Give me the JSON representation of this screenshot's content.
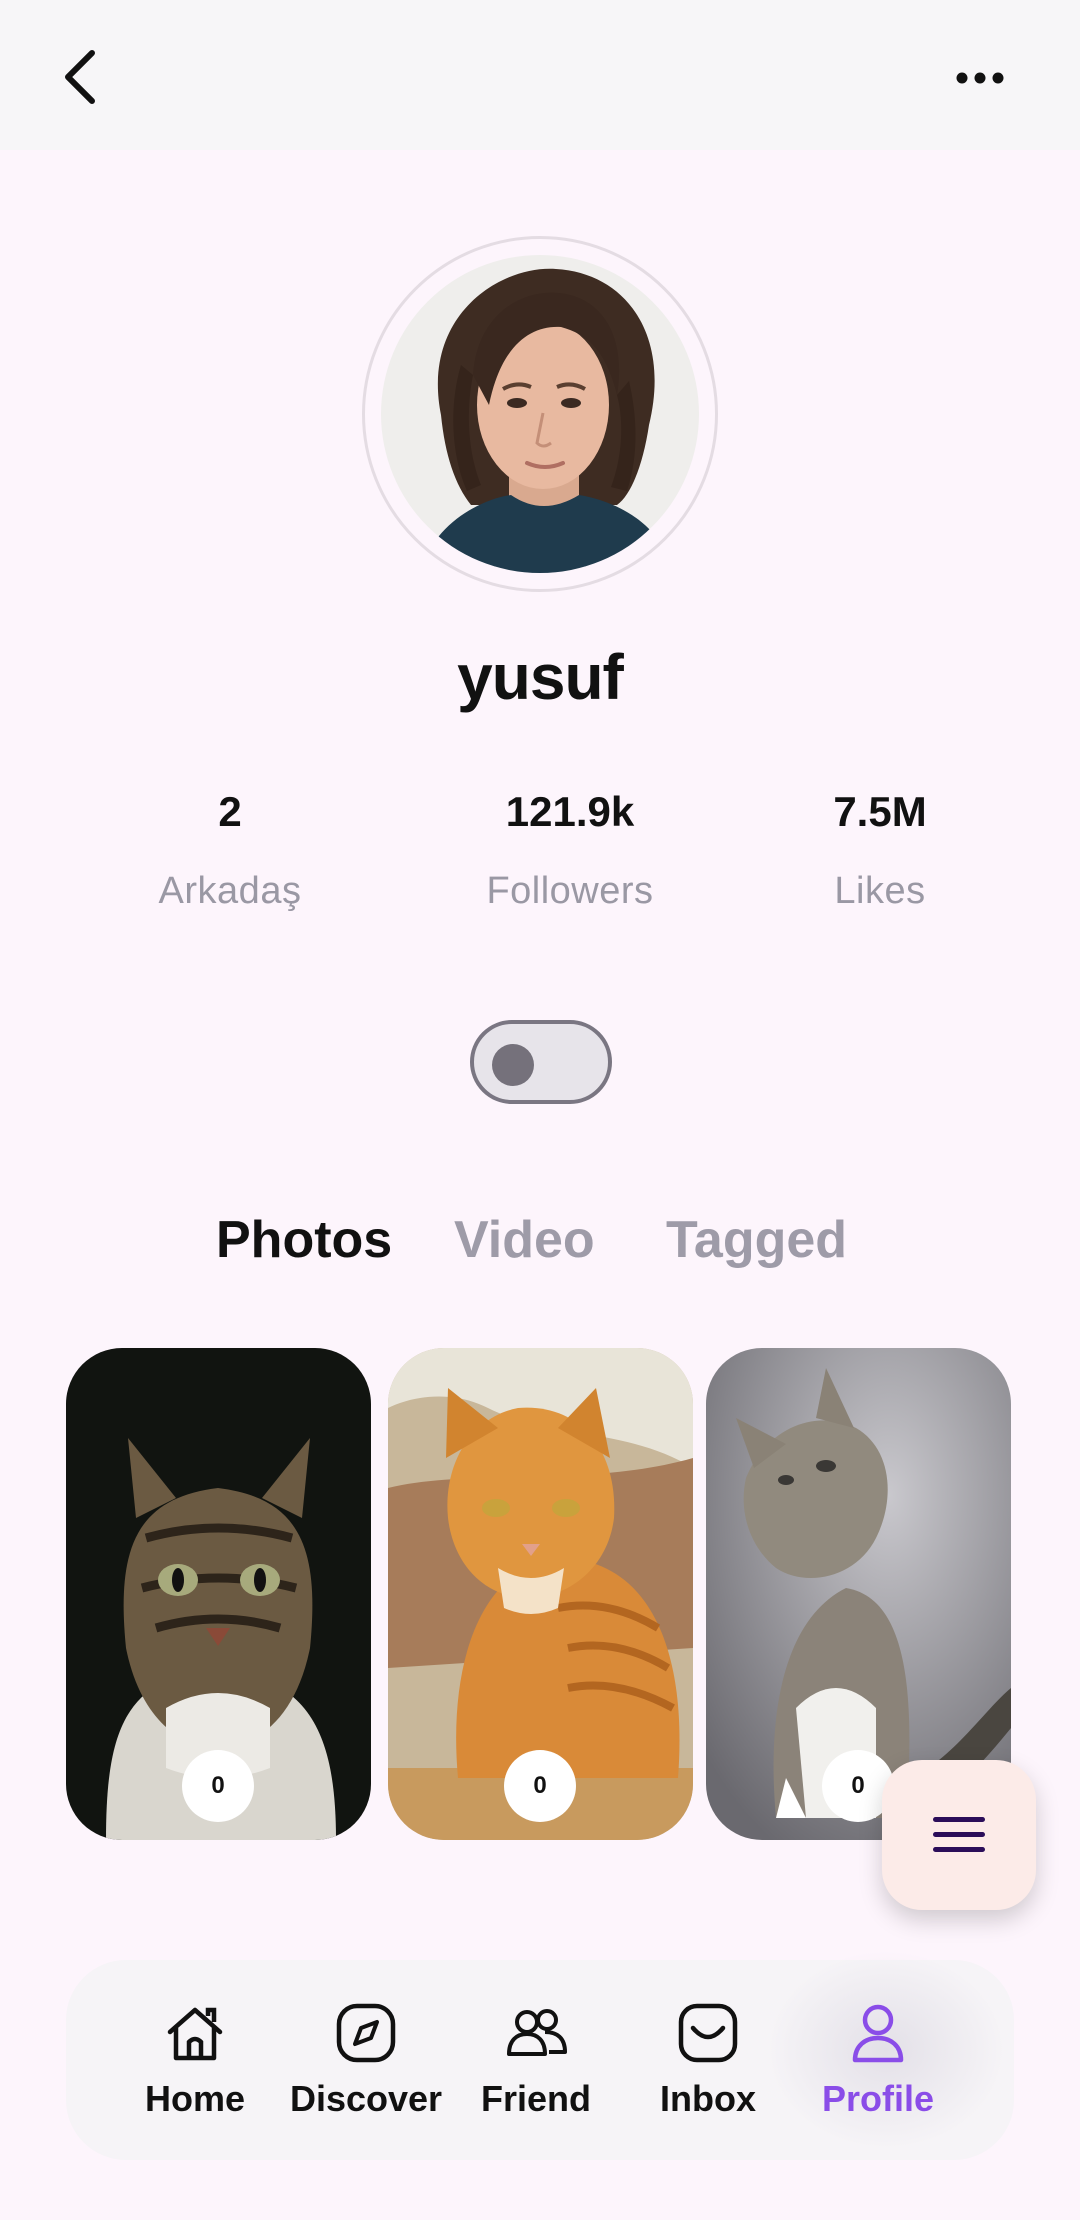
{
  "header": {
    "back_icon": "chevron-left-icon",
    "more_icon": "more-horizontal-icon"
  },
  "profile": {
    "username": "yusuf",
    "avatar": "profile-photo"
  },
  "stats": [
    {
      "value": "2",
      "label": "Arkadaş"
    },
    {
      "value": "121.9k",
      "label": "Followers"
    },
    {
      "value": "7.5M",
      "label": "Likes"
    }
  ],
  "toggle": {
    "state": "off"
  },
  "tabs": [
    {
      "label": "Photos",
      "active": true
    },
    {
      "label": "Video",
      "active": false
    },
    {
      "label": "Tagged",
      "active": false
    }
  ],
  "photos": [
    {
      "subject": "tabby cat on dark background",
      "count": "0"
    },
    {
      "subject": "orange cat on ledge",
      "count": "0"
    },
    {
      "subject": "grey kitten looking up",
      "count": "0"
    }
  ],
  "fab": {
    "icon": "menu-icon"
  },
  "nav": [
    {
      "label": "Home",
      "icon": "home-icon",
      "active": false
    },
    {
      "label": "Discover",
      "icon": "compass-icon",
      "active": false
    },
    {
      "label": "Friend",
      "icon": "friends-icon",
      "active": false
    },
    {
      "label": "Inbox",
      "icon": "inbox-icon",
      "active": false
    },
    {
      "label": "Profile",
      "icon": "profile-icon",
      "active": true
    }
  ],
  "colors": {
    "background": "#fdf5fc",
    "accent": "#8a4de8",
    "muted_text": "#9a98a4",
    "fab_background": "#fcebe8",
    "fab_icon": "#2b0d59"
  }
}
